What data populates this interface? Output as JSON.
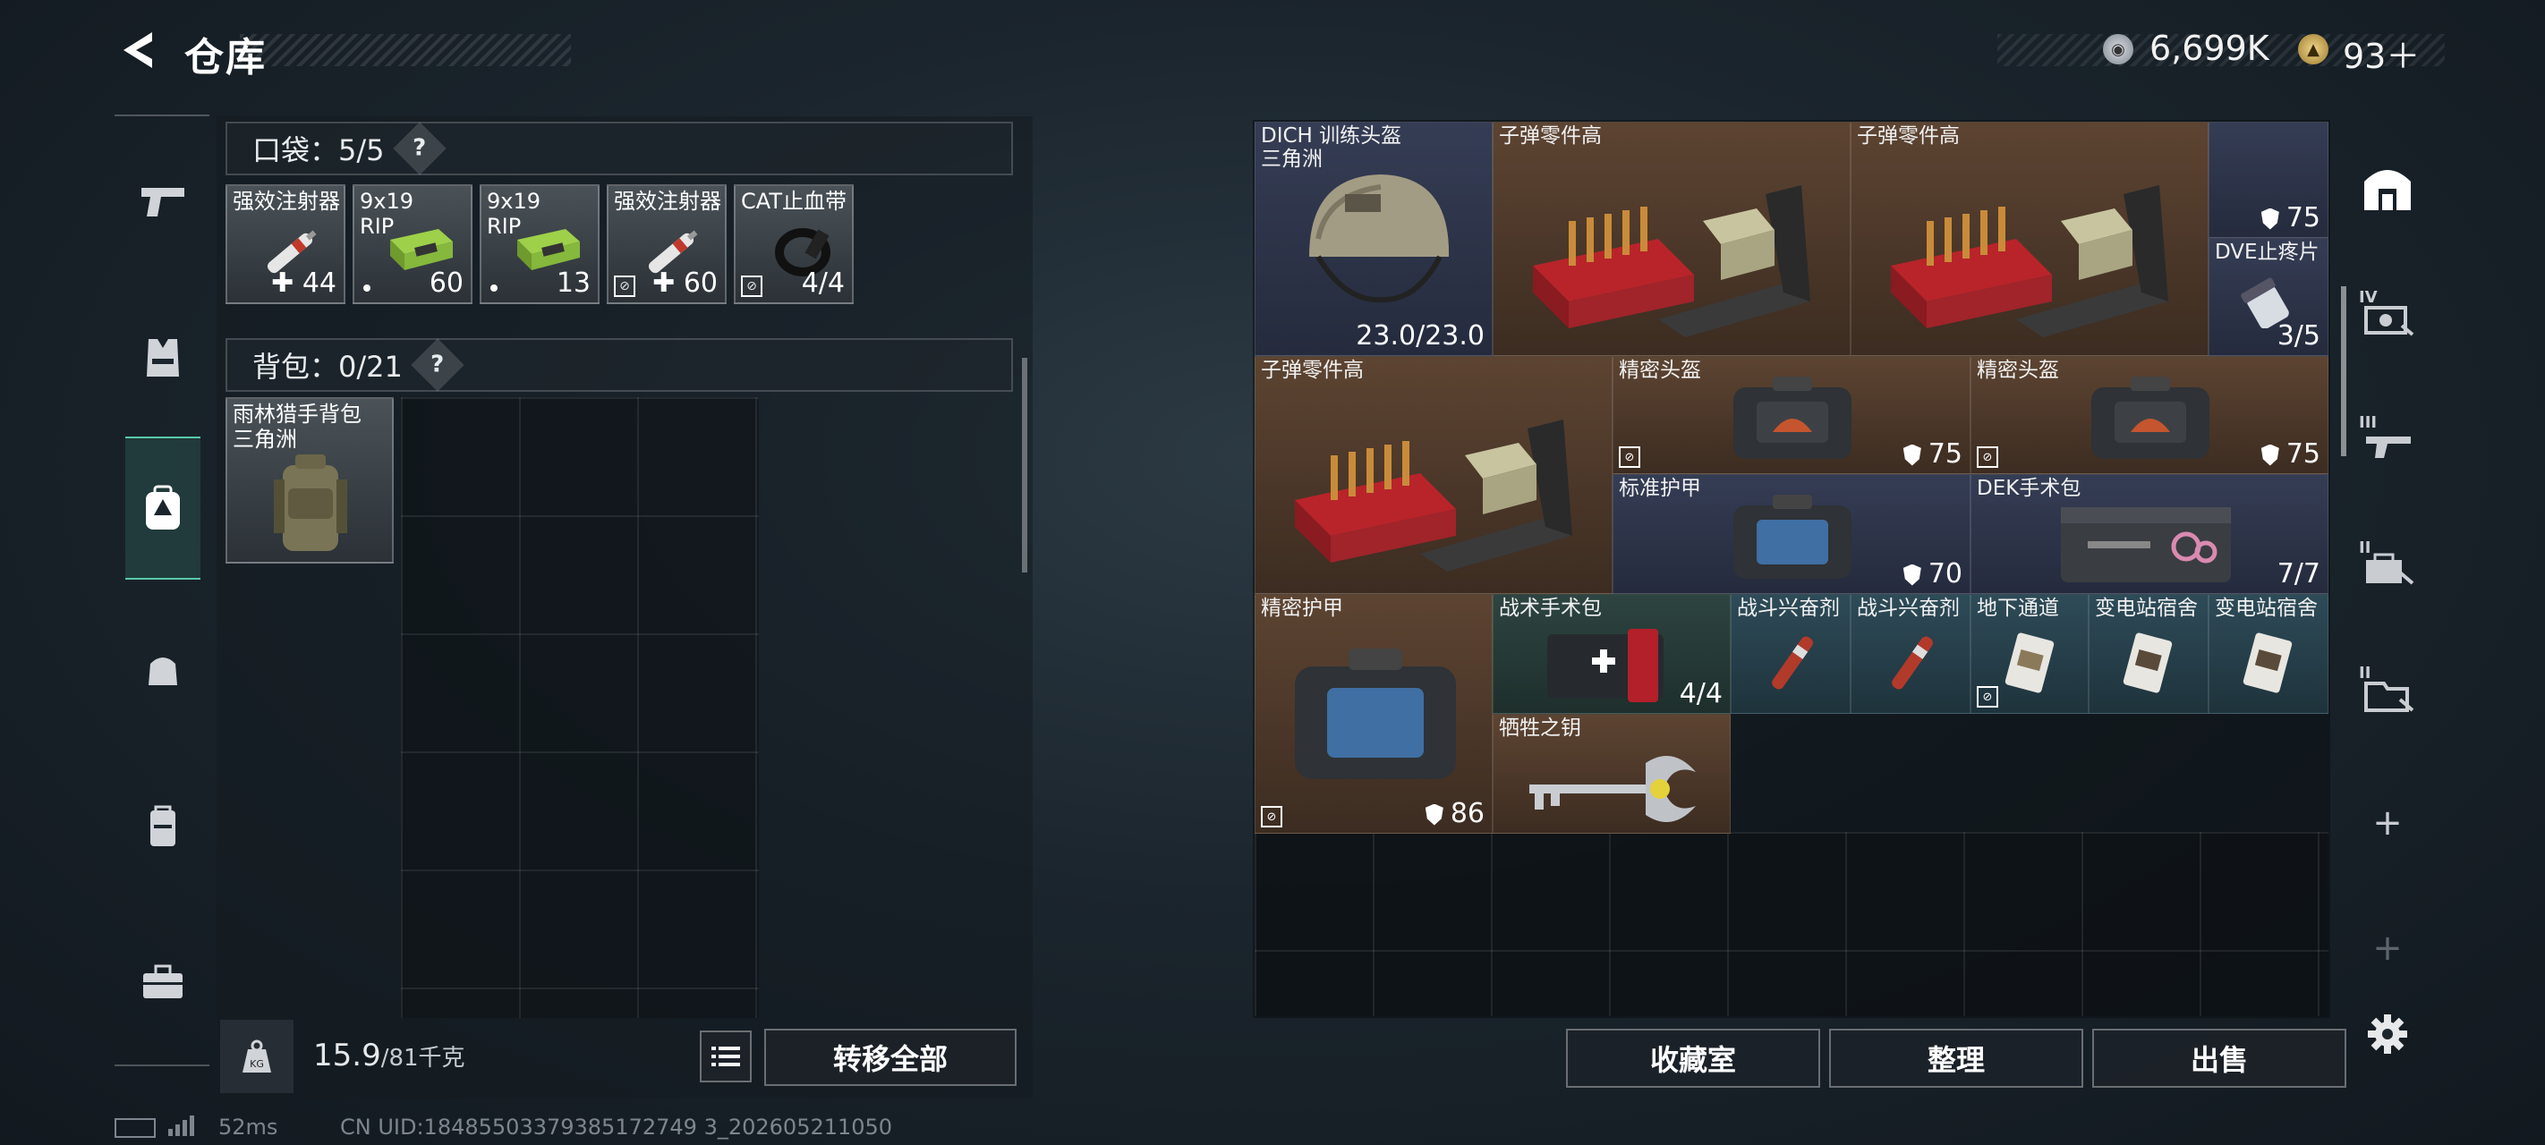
{
  "header": {
    "back_icon": "chevron-left-icon",
    "title": "仓库",
    "currency_silver": "6,699K",
    "currency_gold": "93＋"
  },
  "left_nav": {
    "items": [
      {
        "icon": "pistol-icon"
      },
      {
        "icon": "vest-icon"
      },
      {
        "icon": "backpack-active-icon"
      },
      {
        "icon": "pouch-icon"
      },
      {
        "icon": "rig-icon"
      },
      {
        "icon": "toolbox-icon"
      }
    ]
  },
  "pocket": {
    "label": "口袋：5/5",
    "help": "?",
    "items": [
      {
        "name": "强效注射器",
        "count": "44",
        "plus": true
      },
      {
        "name": "9x19\nRIP",
        "count": "60",
        "dot": true
      },
      {
        "name": "9x19\nRIP",
        "count": "13",
        "dot": true
      },
      {
        "name": "强效注射器",
        "count": "60",
        "plus": true,
        "locked": true
      },
      {
        "name": "CAT止血带",
        "count": "4/4",
        "locked": true
      }
    ]
  },
  "backpack": {
    "label": "背包：0/21",
    "help": "?",
    "equipped_name": "雨林猎手背包\n三角洲"
  },
  "bottom_left": {
    "weight": "15.9",
    "weight_max": "/81千克",
    "transfer_all": "转移全部"
  },
  "stash": {
    "items": [
      {
        "name": "DICH 训练头盔\n三角洲",
        "count": "23.0/23.0"
      },
      {
        "name": "子弹零件高"
      },
      {
        "name": "子弹零件高"
      },
      {
        "name": "",
        "count": "75",
        "shield": true
      },
      {
        "name": "DVE止疼片",
        "count": "3/5"
      },
      {
        "name": "子弹零件高"
      },
      {
        "name": "精密头盔",
        "count": "75",
        "shield": true,
        "locked": true
      },
      {
        "name": "精密头盔",
        "count": "75",
        "shield": true,
        "locked": true
      },
      {
        "name": "标准护甲",
        "count": "70",
        "shield": true
      },
      {
        "name": "DEK手术包",
        "count": "7/7"
      },
      {
        "name": "精密护甲",
        "count": "86",
        "shield": true,
        "locked": true
      },
      {
        "name": "战术手术包",
        "count": "4/4"
      },
      {
        "name": "战斗兴奋剂"
      },
      {
        "name": "战斗兴奋剂"
      },
      {
        "name": "地下通道",
        "locked": true
      },
      {
        "name": "变电站宿舍"
      },
      {
        "name": "变电站宿舍"
      },
      {
        "name": "牺牲之钥"
      }
    ]
  },
  "bottom_right": {
    "collection": "收藏室",
    "sort": "整理",
    "sell": "出售"
  },
  "right_nav": {
    "items": [
      {
        "icon": "stash-home-icon",
        "label": ""
      },
      {
        "icon": "page-iv-icon",
        "label": "IV"
      },
      {
        "icon": "page-iii-icon",
        "label": "III"
      },
      {
        "icon": "page-ii-icon",
        "label": "II"
      },
      {
        "icon": "page-i-icon",
        "label": "II"
      },
      {
        "icon": "add-page-icon",
        "label": "+"
      },
      {
        "icon": "add-page-disabled-icon",
        "label": "+"
      },
      {
        "icon": "settings-gear-icon",
        "label": "⚙"
      }
    ]
  },
  "status": {
    "ping": "52ms",
    "uid": "CN UID:18485503379385172749 3_202605211050"
  }
}
